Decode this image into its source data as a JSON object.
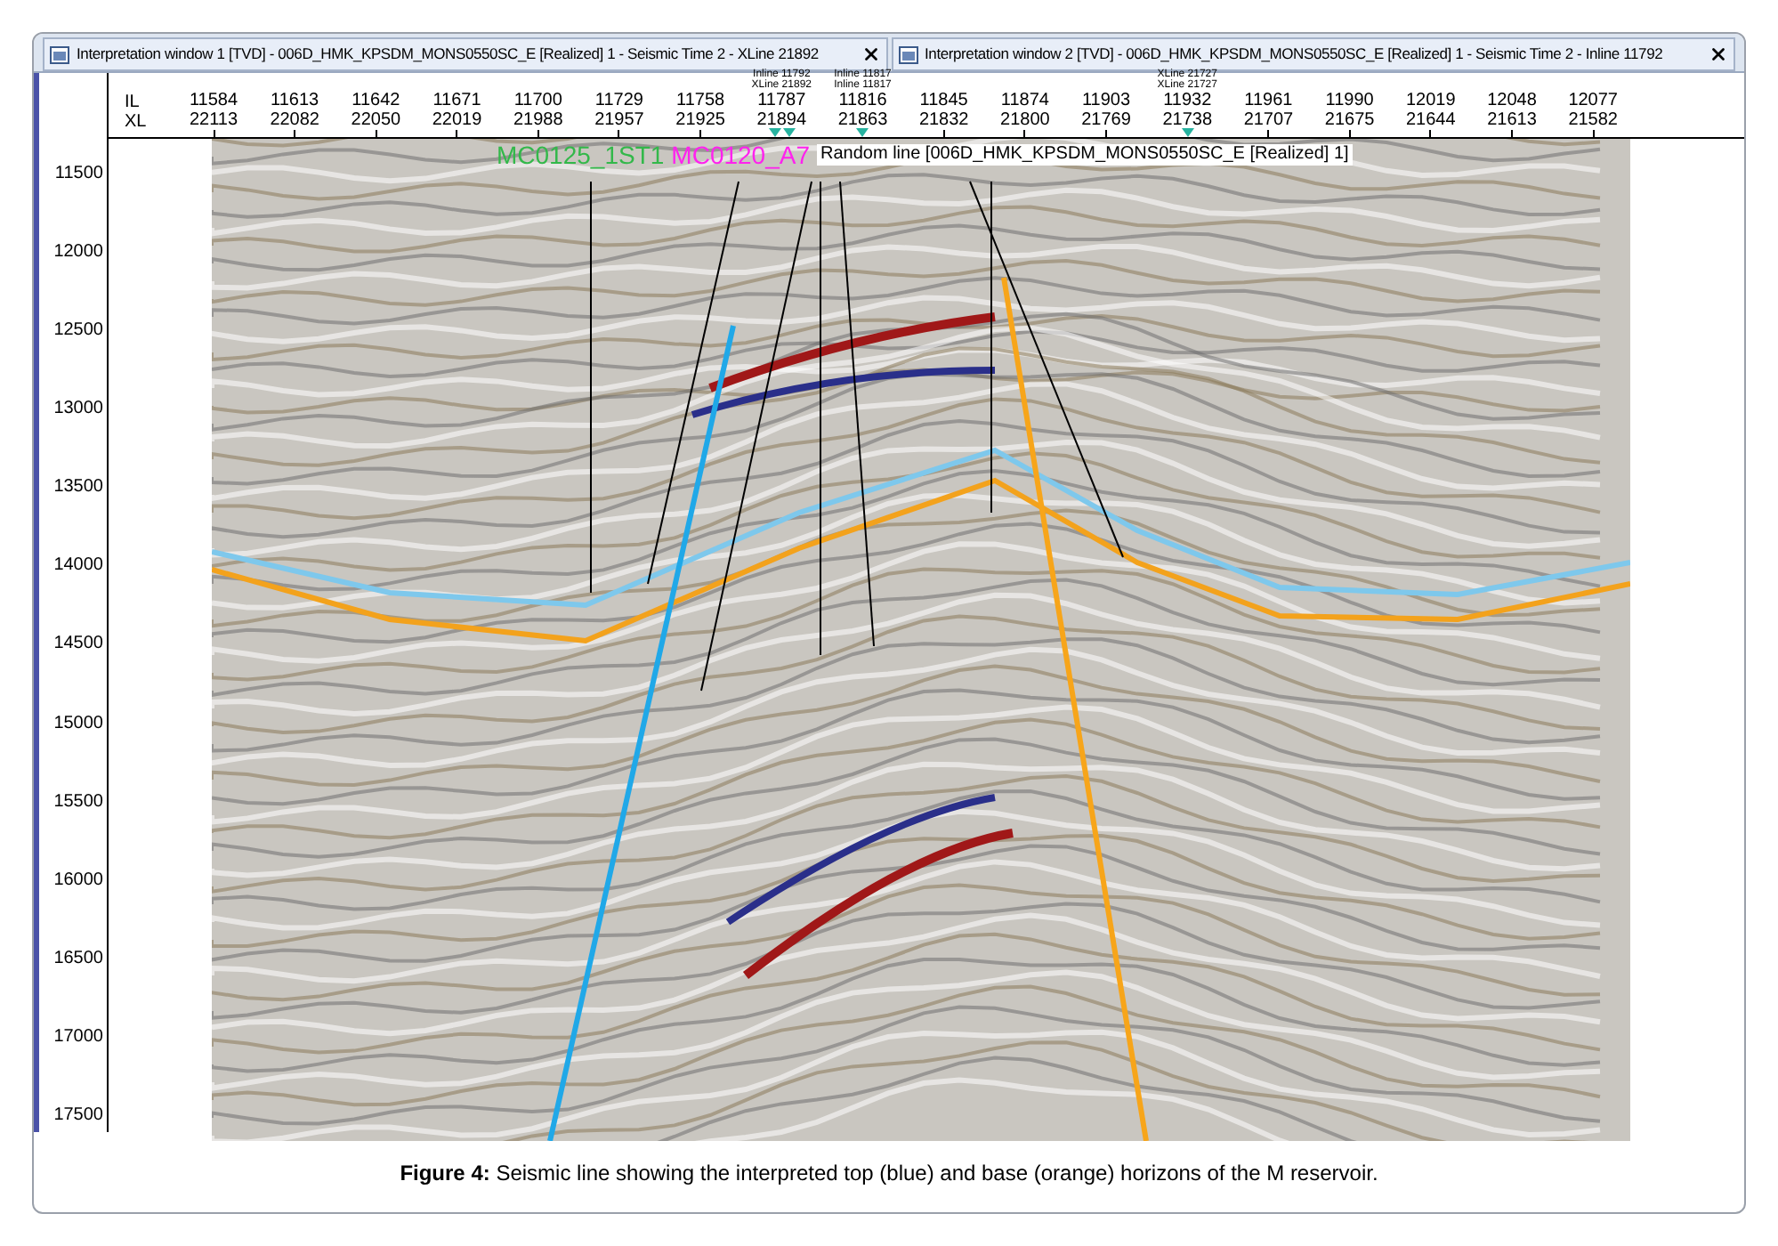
{
  "tabs": [
    {
      "title": "Interpretation window 1 [TVD] - 006D_HMK_KPSDM_MONS0550SC_E [Realized] 1 - Seismic Time 2 - XLine 21892"
    },
    {
      "title": "Interpretation window 2 [TVD] - 006D_HMK_KPSDM_MONS0550SC_E [Realized] 1 - Seismic Time 2 - Inline 11792"
    }
  ],
  "axis_header": {
    "il_label": "IL",
    "xl_label": "XL",
    "columns": [
      {
        "il": "11584",
        "xl": "22113"
      },
      {
        "il": "11613",
        "xl": "22082"
      },
      {
        "il": "11642",
        "xl": "22050"
      },
      {
        "il": "11671",
        "xl": "22019"
      },
      {
        "il": "11700",
        "xl": "21988"
      },
      {
        "il": "11729",
        "xl": "21957"
      },
      {
        "il": "11758",
        "xl": "21925"
      },
      {
        "il": "11787",
        "xl": "21894",
        "notes": [
          "Inline 11792",
          "XLine 21892"
        ],
        "markers": [
          {
            "kind": "triangle"
          },
          {
            "kind": "triangle"
          }
        ]
      },
      {
        "il": "11816",
        "xl": "21863",
        "notes": [
          "Inline 11817",
          "Inline 11817"
        ],
        "markers": [
          {
            "kind": "triangle"
          }
        ]
      },
      {
        "il": "11845",
        "xl": "21832"
      },
      {
        "il": "11874",
        "xl": "21800"
      },
      {
        "il": "11903",
        "xl": "21769"
      },
      {
        "il": "11932",
        "xl": "21738",
        "notes": [
          "XLine 21727",
          "XLine 21727"
        ],
        "markers": [
          {
            "kind": "triangle"
          }
        ]
      },
      {
        "il": "11961",
        "xl": "21707"
      },
      {
        "il": "11990",
        "xl": "21675"
      },
      {
        "il": "12019",
        "xl": "21644"
      },
      {
        "il": "12048",
        "xl": "21613"
      },
      {
        "il": "12077",
        "xl": "21582"
      }
    ]
  },
  "depth_axis": [
    "11500",
    "12000",
    "12500",
    "13000",
    "13500",
    "14000",
    "14500",
    "15000",
    "15500",
    "16000",
    "16500",
    "17000",
    "17500"
  ],
  "section": {
    "line_label": "Random line [006D_HMK_KPSDM_MONS0550SC_E [Realized] 1]",
    "well_labels": [
      {
        "text": "MC0125_1ST1",
        "color": "#33b84a"
      },
      {
        "text": "MC0120_A7",
        "color": "#ff22ee"
      }
    ]
  },
  "caption": "**Figure 4:** Seismic line showing the interpreted top (blue) and base (orange) horizons of the M reservoir."
}
